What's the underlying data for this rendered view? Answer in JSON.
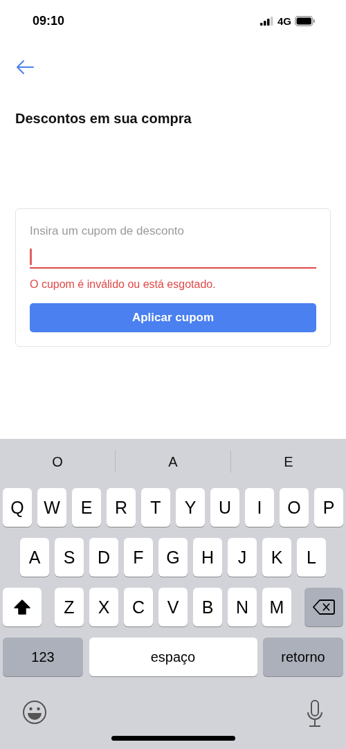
{
  "status_bar": {
    "time": "09:10",
    "network": "4G"
  },
  "header": {
    "title": "Descontos em sua compra"
  },
  "coupon_form": {
    "placeholder": "Insira um cupom de desconto",
    "focused": true,
    "invalid": true,
    "error": "O cupom é inválido ou está esgotado.",
    "button": "Aplicar cupom"
  },
  "keyboard": {
    "suggestions": [
      "O",
      "A",
      "E"
    ],
    "rows": [
      [
        {
          "kind": "letter",
          "label": "Q"
        },
        {
          "kind": "letter",
          "label": "W"
        },
        {
          "kind": "letter",
          "label": "E"
        },
        {
          "kind": "letter",
          "label": "R"
        },
        {
          "kind": "letter",
          "label": "T"
        },
        {
          "kind": "letter",
          "label": "Y"
        },
        {
          "kind": "letter",
          "label": "U"
        },
        {
          "kind": "letter",
          "label": "I"
        },
        {
          "kind": "letter",
          "label": "O"
        },
        {
          "kind": "letter",
          "label": "P"
        }
      ],
      [
        {
          "kind": "letter",
          "label": "A"
        },
        {
          "kind": "letter",
          "label": "S"
        },
        {
          "kind": "letter",
          "label": "D"
        },
        {
          "kind": "letter",
          "label": "F"
        },
        {
          "kind": "letter",
          "label": "G"
        },
        {
          "kind": "letter",
          "label": "H"
        },
        {
          "kind": "letter",
          "label": "J"
        },
        {
          "kind": "letter",
          "label": "K"
        },
        {
          "kind": "letter",
          "label": "L"
        }
      ],
      [
        {
          "kind": "shift",
          "on": true
        },
        {
          "kind": "letter",
          "label": "Z"
        },
        {
          "kind": "letter",
          "label": "X"
        },
        {
          "kind": "letter",
          "label": "C"
        },
        {
          "kind": "letter",
          "label": "V"
        },
        {
          "kind": "letter",
          "label": "B"
        },
        {
          "kind": "letter",
          "label": "N"
        },
        {
          "kind": "letter",
          "label": "M"
        },
        {
          "kind": "delete"
        }
      ]
    ],
    "bottom_row": [
      {
        "kind": "numbers",
        "label": "123"
      },
      {
        "kind": "space",
        "label": "espaço"
      },
      {
        "kind": "return",
        "label": "retorno"
      }
    ]
  }
}
